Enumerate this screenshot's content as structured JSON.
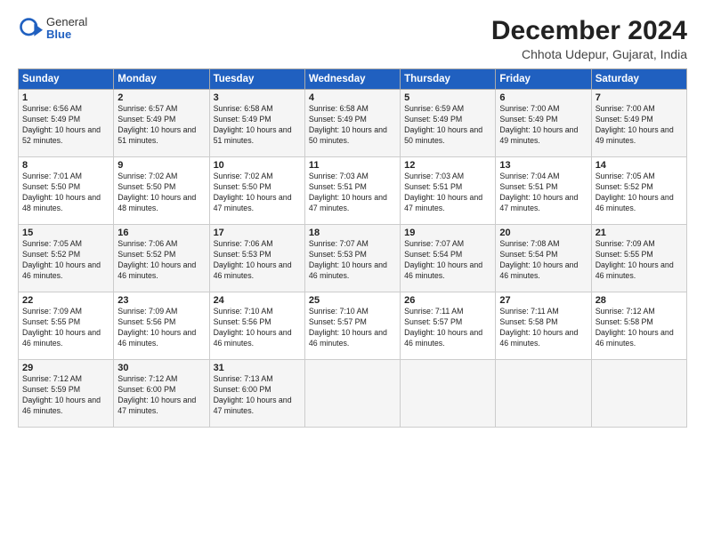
{
  "header": {
    "logo_general": "General",
    "logo_blue": "Blue",
    "title": "December 2024",
    "location": "Chhota Udepur, Gujarat, India"
  },
  "columns": [
    "Sunday",
    "Monday",
    "Tuesday",
    "Wednesday",
    "Thursday",
    "Friday",
    "Saturday"
  ],
  "weeks": [
    [
      {
        "day": "1",
        "sunrise": "Sunrise: 6:56 AM",
        "sunset": "Sunset: 5:49 PM",
        "daylight": "Daylight: 10 hours and 52 minutes."
      },
      {
        "day": "2",
        "sunrise": "Sunrise: 6:57 AM",
        "sunset": "Sunset: 5:49 PM",
        "daylight": "Daylight: 10 hours and 51 minutes."
      },
      {
        "day": "3",
        "sunrise": "Sunrise: 6:58 AM",
        "sunset": "Sunset: 5:49 PM",
        "daylight": "Daylight: 10 hours and 51 minutes."
      },
      {
        "day": "4",
        "sunrise": "Sunrise: 6:58 AM",
        "sunset": "Sunset: 5:49 PM",
        "daylight": "Daylight: 10 hours and 50 minutes."
      },
      {
        "day": "5",
        "sunrise": "Sunrise: 6:59 AM",
        "sunset": "Sunset: 5:49 PM",
        "daylight": "Daylight: 10 hours and 50 minutes."
      },
      {
        "day": "6",
        "sunrise": "Sunrise: 7:00 AM",
        "sunset": "Sunset: 5:49 PM",
        "daylight": "Daylight: 10 hours and 49 minutes."
      },
      {
        "day": "7",
        "sunrise": "Sunrise: 7:00 AM",
        "sunset": "Sunset: 5:49 PM",
        "daylight": "Daylight: 10 hours and 49 minutes."
      }
    ],
    [
      {
        "day": "8",
        "sunrise": "Sunrise: 7:01 AM",
        "sunset": "Sunset: 5:50 PM",
        "daylight": "Daylight: 10 hours and 48 minutes."
      },
      {
        "day": "9",
        "sunrise": "Sunrise: 7:02 AM",
        "sunset": "Sunset: 5:50 PM",
        "daylight": "Daylight: 10 hours and 48 minutes."
      },
      {
        "day": "10",
        "sunrise": "Sunrise: 7:02 AM",
        "sunset": "Sunset: 5:50 PM",
        "daylight": "Daylight: 10 hours and 47 minutes."
      },
      {
        "day": "11",
        "sunrise": "Sunrise: 7:03 AM",
        "sunset": "Sunset: 5:51 PM",
        "daylight": "Daylight: 10 hours and 47 minutes."
      },
      {
        "day": "12",
        "sunrise": "Sunrise: 7:03 AM",
        "sunset": "Sunset: 5:51 PM",
        "daylight": "Daylight: 10 hours and 47 minutes."
      },
      {
        "day": "13",
        "sunrise": "Sunrise: 7:04 AM",
        "sunset": "Sunset: 5:51 PM",
        "daylight": "Daylight: 10 hours and 47 minutes."
      },
      {
        "day": "14",
        "sunrise": "Sunrise: 7:05 AM",
        "sunset": "Sunset: 5:52 PM",
        "daylight": "Daylight: 10 hours and 46 minutes."
      }
    ],
    [
      {
        "day": "15",
        "sunrise": "Sunrise: 7:05 AM",
        "sunset": "Sunset: 5:52 PM",
        "daylight": "Daylight: 10 hours and 46 minutes."
      },
      {
        "day": "16",
        "sunrise": "Sunrise: 7:06 AM",
        "sunset": "Sunset: 5:52 PM",
        "daylight": "Daylight: 10 hours and 46 minutes."
      },
      {
        "day": "17",
        "sunrise": "Sunrise: 7:06 AM",
        "sunset": "Sunset: 5:53 PM",
        "daylight": "Daylight: 10 hours and 46 minutes."
      },
      {
        "day": "18",
        "sunrise": "Sunrise: 7:07 AM",
        "sunset": "Sunset: 5:53 PM",
        "daylight": "Daylight: 10 hours and 46 minutes."
      },
      {
        "day": "19",
        "sunrise": "Sunrise: 7:07 AM",
        "sunset": "Sunset: 5:54 PM",
        "daylight": "Daylight: 10 hours and 46 minutes."
      },
      {
        "day": "20",
        "sunrise": "Sunrise: 7:08 AM",
        "sunset": "Sunset: 5:54 PM",
        "daylight": "Daylight: 10 hours and 46 minutes."
      },
      {
        "day": "21",
        "sunrise": "Sunrise: 7:09 AM",
        "sunset": "Sunset: 5:55 PM",
        "daylight": "Daylight: 10 hours and 46 minutes."
      }
    ],
    [
      {
        "day": "22",
        "sunrise": "Sunrise: 7:09 AM",
        "sunset": "Sunset: 5:55 PM",
        "daylight": "Daylight: 10 hours and 46 minutes."
      },
      {
        "day": "23",
        "sunrise": "Sunrise: 7:09 AM",
        "sunset": "Sunset: 5:56 PM",
        "daylight": "Daylight: 10 hours and 46 minutes."
      },
      {
        "day": "24",
        "sunrise": "Sunrise: 7:10 AM",
        "sunset": "Sunset: 5:56 PM",
        "daylight": "Daylight: 10 hours and 46 minutes."
      },
      {
        "day": "25",
        "sunrise": "Sunrise: 7:10 AM",
        "sunset": "Sunset: 5:57 PM",
        "daylight": "Daylight: 10 hours and 46 minutes."
      },
      {
        "day": "26",
        "sunrise": "Sunrise: 7:11 AM",
        "sunset": "Sunset: 5:57 PM",
        "daylight": "Daylight: 10 hours and 46 minutes."
      },
      {
        "day": "27",
        "sunrise": "Sunrise: 7:11 AM",
        "sunset": "Sunset: 5:58 PM",
        "daylight": "Daylight: 10 hours and 46 minutes."
      },
      {
        "day": "28",
        "sunrise": "Sunrise: 7:12 AM",
        "sunset": "Sunset: 5:58 PM",
        "daylight": "Daylight: 10 hours and 46 minutes."
      }
    ],
    [
      {
        "day": "29",
        "sunrise": "Sunrise: 7:12 AM",
        "sunset": "Sunset: 5:59 PM",
        "daylight": "Daylight: 10 hours and 46 minutes."
      },
      {
        "day": "30",
        "sunrise": "Sunrise: 7:12 AM",
        "sunset": "Sunset: 6:00 PM",
        "daylight": "Daylight: 10 hours and 47 minutes."
      },
      {
        "day": "31",
        "sunrise": "Sunrise: 7:13 AM",
        "sunset": "Sunset: 6:00 PM",
        "daylight": "Daylight: 10 hours and 47 minutes."
      },
      {
        "day": "",
        "sunrise": "",
        "sunset": "",
        "daylight": ""
      },
      {
        "day": "",
        "sunrise": "",
        "sunset": "",
        "daylight": ""
      },
      {
        "day": "",
        "sunrise": "",
        "sunset": "",
        "daylight": ""
      },
      {
        "day": "",
        "sunrise": "",
        "sunset": "",
        "daylight": ""
      }
    ]
  ]
}
